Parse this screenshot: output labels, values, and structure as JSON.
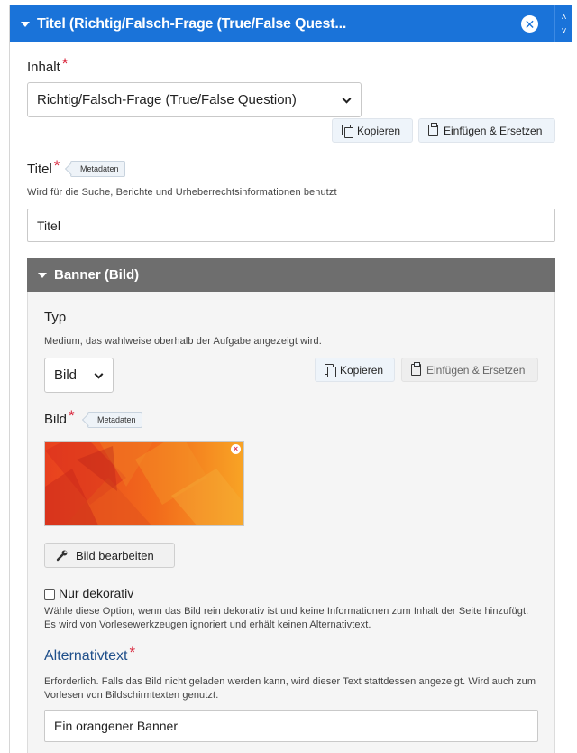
{
  "topbar": {
    "title": "Titel (Richtig/Falsch-Frage (True/False Quest..."
  },
  "content": {
    "label": "Inhalt",
    "select_value": "Richtig/Falsch-Frage (True/False Question)",
    "copy_label": "Kopieren",
    "paste_label": "Einfügen & Ersetzen"
  },
  "title_field": {
    "label": "Titel",
    "badge": "Metadaten",
    "description": "Wird für die Suche, Berichte und Urheberrechtsinformationen benutzt",
    "value": "Titel"
  },
  "banner": {
    "header": "Banner (Bild)",
    "type_label": "Typ",
    "type_description": "Medium, das wahlweise oberhalb der Aufgabe angezeigt wird.",
    "type_value": "Bild",
    "copy_label": "Kopieren",
    "paste_label": "Einfügen & Ersetzen",
    "image_label": "Bild",
    "image_badge": "Metadaten",
    "edit_label": "Bild bearbeiten",
    "decorative_label": "Nur dekorativ",
    "decorative_description": "Wähle diese Option, wenn das Bild rein dekorativ ist und keine Informationen zum Inhalt der Seite hinzufügt. Es wird von Vorlesewerkzeugen ignoriert und erhält keinen Alternativtext.",
    "alt_label": "Alternativtext",
    "alt_description": "Erforderlich. Falls das Bild nicht geladen werden kann, wird dieser Text stattdessen angezeigt. Wird auch zum Vorlesen von Bildschirmtexten genutzt.",
    "alt_value": "Ein orangener Banner"
  },
  "colors": {
    "accent": "#1a73d9",
    "section_header": "#6e6e6e",
    "required": "#d9263c"
  }
}
